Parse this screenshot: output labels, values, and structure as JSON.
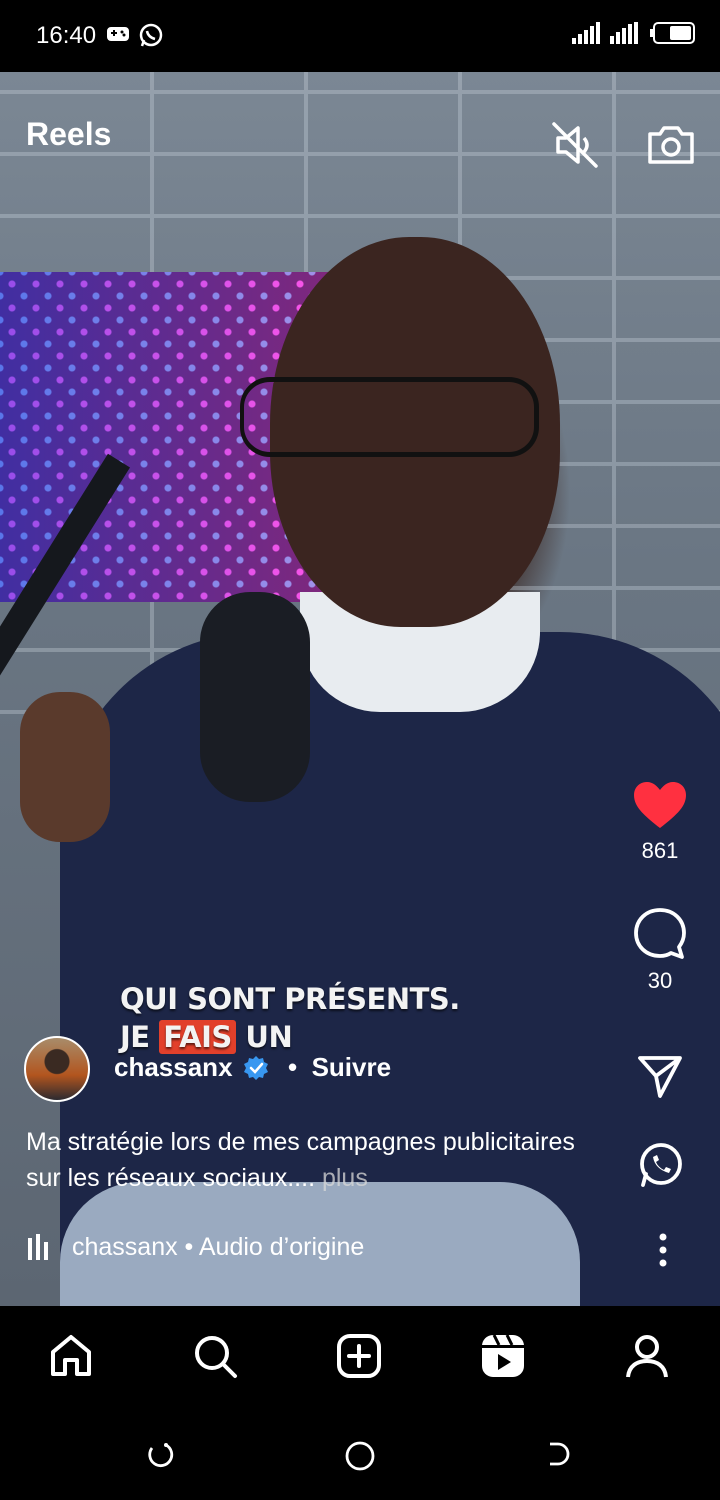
{
  "status_bar": {
    "time": "16:40"
  },
  "header": {
    "title": "Reels"
  },
  "video": {
    "subtitle_line1": "QUI SONT PRÉSENTS.",
    "subtitle_line2_a": "JE ",
    "subtitle_line2_highlight": "FAIS",
    "subtitle_line2_b": " UN"
  },
  "actions": {
    "likes": "861",
    "comments": "30"
  },
  "author": {
    "username": "chassanx",
    "follow": "Suivre",
    "separator": "•"
  },
  "caption": {
    "text": "Ma stratégie lors de mes campagnes publicitaires sur les réseaux sociaux....",
    "more": "plus"
  },
  "audio": {
    "text": "chassanx • Audio d’origine"
  },
  "colors": {
    "like": "#ff3040",
    "verified": "#3897f0",
    "background": "#000000"
  },
  "icons": [
    "mute-icon",
    "camera-icon",
    "heart-icon",
    "comment-icon",
    "share-icon",
    "whatsapp-icon",
    "more-icon",
    "home-icon",
    "search-icon",
    "create-icon",
    "reels-icon",
    "profile-icon"
  ]
}
